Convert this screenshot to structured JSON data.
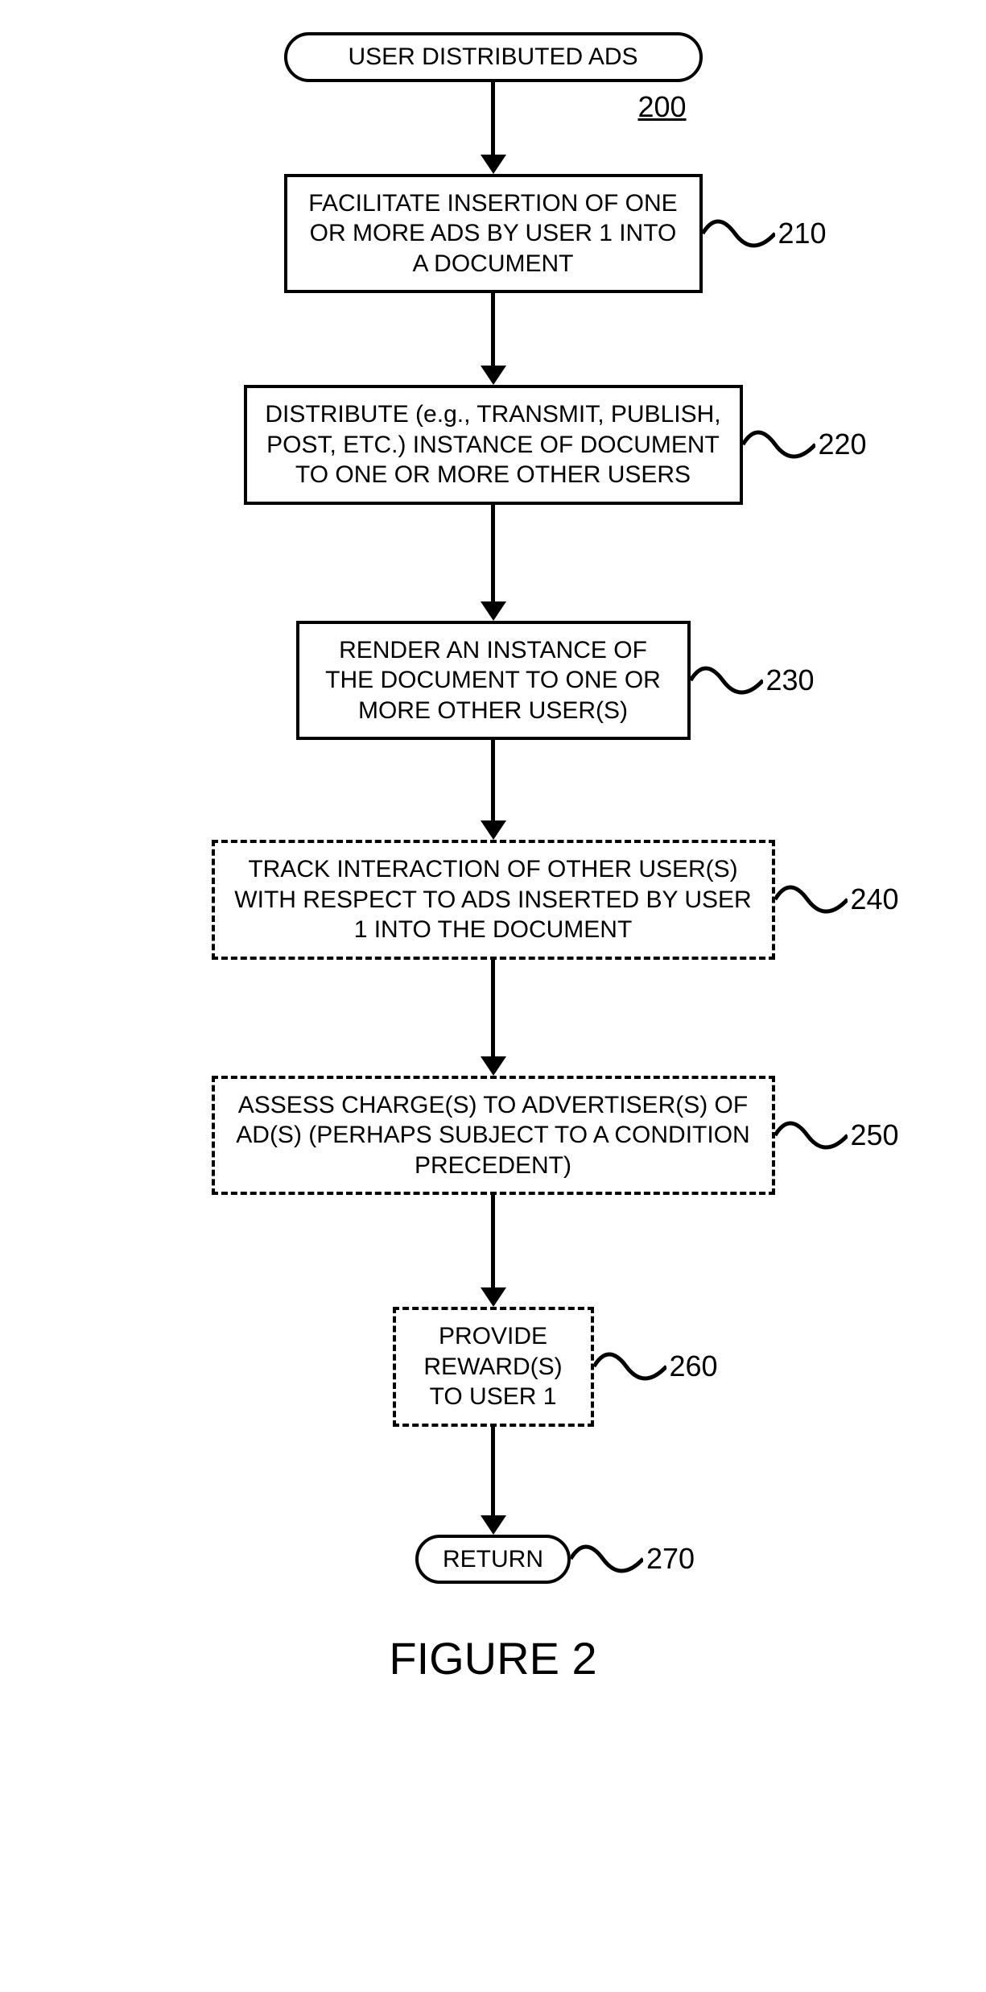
{
  "title_ref": "200",
  "nodes": {
    "start": {
      "text": "USER DISTRIBUTED ADS"
    },
    "n210": {
      "text": "FACILITATE INSERTION OF ONE OR MORE ADS BY USER 1 INTO A DOCUMENT",
      "ref": "210"
    },
    "n220": {
      "text": "DISTRIBUTE (e.g., TRANSMIT, PUBLISH, POST, ETC.) INSTANCE OF DOCUMENT TO ONE OR MORE OTHER USERS",
      "ref": "220"
    },
    "n230": {
      "text": "RENDER AN INSTANCE OF THE DOCUMENT TO ONE OR MORE  OTHER USER(S)",
      "ref": "230"
    },
    "n240": {
      "text": "TRACK INTERACTION OF OTHER USER(S) WITH RESPECT TO ADS INSERTED BY USER 1 INTO THE DOCUMENT",
      "ref": "240"
    },
    "n250": {
      "text": "ASSESS CHARGE(S) TO ADVERTISER(S) OF AD(S) (PERHAPS SUBJECT TO A CONDITION PRECEDENT)",
      "ref": "250"
    },
    "n260": {
      "text": "PROVIDE REWARD(S) TO USER 1",
      "ref": "260"
    },
    "end": {
      "text": "RETURN",
      "ref": "270"
    }
  },
  "figure_label": "FIGURE 2"
}
